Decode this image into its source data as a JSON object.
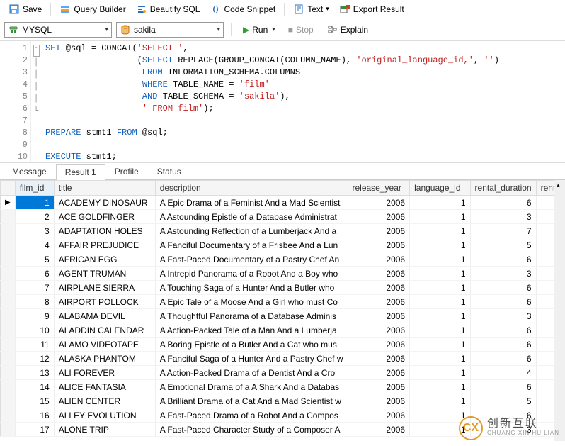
{
  "toolbar": {
    "save": "Save",
    "query_builder": "Query Builder",
    "beautify_sql": "Beautify SQL",
    "code_snippet": "Code Snippet",
    "text": "Text",
    "export_result": "Export Result"
  },
  "row2": {
    "db_type": "MYSQL",
    "schema": "sakila",
    "run": "Run",
    "stop": "Stop",
    "explain": "Explain"
  },
  "code_lines": [
    "SET @sql = CONCAT('SELECT ',",
    "                  (SELECT REPLACE(GROUP_CONCAT(COLUMN_NAME), 'original_language_id,', '')",
    "                   FROM INFORMATION_SCHEMA.COLUMNS",
    "                   WHERE TABLE_NAME = 'film'",
    "                   AND TABLE_SCHEMA = 'sakila'),",
    "                   ' FROM film');",
    "",
    "PREPARE stmt1 FROM @sql;",
    "",
    "EXECUTE stmt1;"
  ],
  "tabs": {
    "message": "Message",
    "result": "Result 1",
    "profile": "Profile",
    "status": "Status"
  },
  "columns": {
    "film_id": "film_id",
    "title": "title",
    "description": "description",
    "release_year": "release_year",
    "language_id": "language_id",
    "rental_duration": "rental_duration",
    "renta": "renta"
  },
  "rows": [
    {
      "id": 1,
      "title": "ACADEMY DINOSAUR",
      "desc": "A Epic Drama of a Feminist And a Mad Scientist",
      "year": 2006,
      "lang": 1,
      "dur": 6
    },
    {
      "id": 2,
      "title": "ACE GOLDFINGER",
      "desc": "A Astounding Epistle of a Database Administrat",
      "year": 2006,
      "lang": 1,
      "dur": 3
    },
    {
      "id": 3,
      "title": "ADAPTATION HOLES",
      "desc": "A Astounding Reflection of a Lumberjack And a",
      "year": 2006,
      "lang": 1,
      "dur": 7
    },
    {
      "id": 4,
      "title": "AFFAIR PREJUDICE",
      "desc": "A Fanciful Documentary of a Frisbee And a Lun",
      "year": 2006,
      "lang": 1,
      "dur": 5
    },
    {
      "id": 5,
      "title": "AFRICAN EGG",
      "desc": "A Fast-Paced Documentary of a Pastry Chef An",
      "year": 2006,
      "lang": 1,
      "dur": 6
    },
    {
      "id": 6,
      "title": "AGENT TRUMAN",
      "desc": "A Intrepid Panorama of a Robot And a Boy who",
      "year": 2006,
      "lang": 1,
      "dur": 3
    },
    {
      "id": 7,
      "title": "AIRPLANE SIERRA",
      "desc": "A Touching Saga of a Hunter And a Butler who",
      "year": 2006,
      "lang": 1,
      "dur": 6
    },
    {
      "id": 8,
      "title": "AIRPORT POLLOCK",
      "desc": "A Epic Tale of a Moose And a Girl who must Co",
      "year": 2006,
      "lang": 1,
      "dur": 6
    },
    {
      "id": 9,
      "title": "ALABAMA DEVIL",
      "desc": "A Thoughtful Panorama of a Database Adminis",
      "year": 2006,
      "lang": 1,
      "dur": 3
    },
    {
      "id": 10,
      "title": "ALADDIN CALENDAR",
      "desc": "A Action-Packed Tale of a Man And a Lumberja",
      "year": 2006,
      "lang": 1,
      "dur": 6
    },
    {
      "id": 11,
      "title": "ALAMO VIDEOTAPE",
      "desc": "A Boring Epistle of a Butler And a Cat who mus",
      "year": 2006,
      "lang": 1,
      "dur": 6
    },
    {
      "id": 12,
      "title": "ALASKA PHANTOM",
      "desc": "A Fanciful Saga of a Hunter And a Pastry Chef w",
      "year": 2006,
      "lang": 1,
      "dur": 6
    },
    {
      "id": 13,
      "title": "ALI FOREVER",
      "desc": "A Action-Packed Drama of a Dentist And a Cro",
      "year": 2006,
      "lang": 1,
      "dur": 4
    },
    {
      "id": 14,
      "title": "ALICE FANTASIA",
      "desc": "A Emotional Drama of a A Shark And a Databas",
      "year": 2006,
      "lang": 1,
      "dur": 6
    },
    {
      "id": 15,
      "title": "ALIEN CENTER",
      "desc": "A Brilliant Drama of a Cat And a Mad Scientist w",
      "year": 2006,
      "lang": 1,
      "dur": 5
    },
    {
      "id": 16,
      "title": "ALLEY EVOLUTION",
      "desc": "A Fast-Paced Drama of a Robot And a Compos",
      "year": 2006,
      "lang": 1,
      "dur": 6
    },
    {
      "id": 17,
      "title": "ALONE TRIP",
      "desc": "A Fast-Paced Character Study of a Composer A",
      "year": 2006,
      "lang": 1,
      "dur": 3
    }
  ],
  "watermark": {
    "logo": "CX",
    "big": "创新互联",
    "small": "CHUANG XIN HU LIAN"
  }
}
